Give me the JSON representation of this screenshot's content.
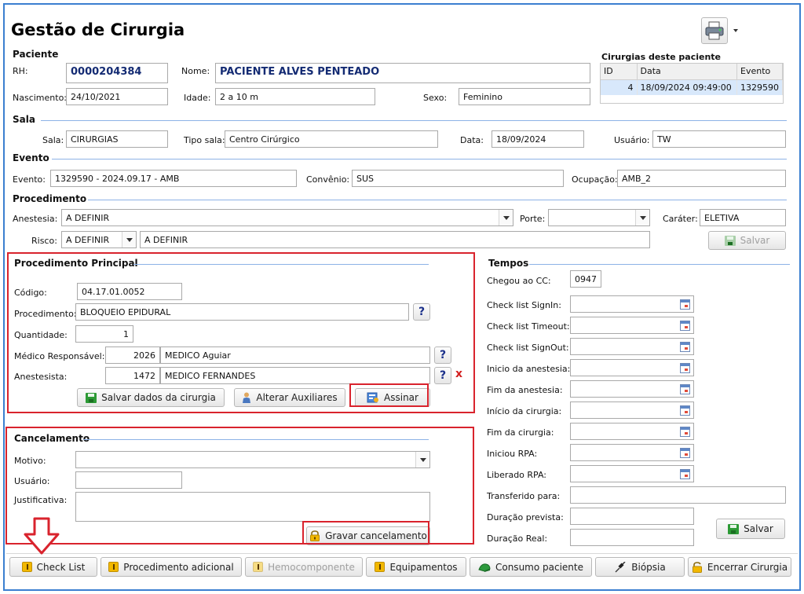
{
  "title": "Gestão de Cirurgia",
  "paciente": {
    "section": "Paciente",
    "rh_label": "RH:",
    "rh_value": "0000204384",
    "nome_label": "Nome:",
    "nome_value": "PACIENTE ALVES PENTEADO",
    "nascimento_label": "Nascimento:",
    "nascimento_value": "24/10/2021",
    "idade_label": "Idade:",
    "idade_value": "2 a 10 m",
    "sexo_label": "Sexo:",
    "sexo_value": "Feminino"
  },
  "cirurgias": {
    "title": "Cirurgias deste paciente",
    "headers": [
      "ID",
      "Data",
      "Evento"
    ],
    "rows": [
      {
        "id": "4",
        "data": "18/09/2024 09:49:00",
        "evento": "1329590"
      }
    ]
  },
  "sala": {
    "section": "Sala",
    "sala_label": "Sala:",
    "sala_value": "CIRURGIAS",
    "tipo_label": "Tipo sala:",
    "tipo_value": "Centro Cirúrgico",
    "data_label": "Data:",
    "data_value": "18/09/2024",
    "usuario_label": "Usuário:",
    "usuario_value": "TW"
  },
  "evento": {
    "section": "Evento",
    "evento_label": "Evento:",
    "evento_value": "1329590 - 2024.09.17 - AMB",
    "convenio_label": "Convênio:",
    "convenio_value": "SUS",
    "ocupacao_label": "Ocupação:",
    "ocupacao_value": "AMB_2"
  },
  "procedimento": {
    "section": "Procedimento",
    "anestesia_label": "Anestesia:",
    "anestesia_value": "A DEFINIR",
    "porte_label": "Porte:",
    "porte_value": "",
    "carater_label": "Caráter:",
    "carater_value": "ELETIVA",
    "risco_label": "Risco:",
    "risco_value": "A DEFINIR",
    "risco_desc": "A DEFINIR",
    "salvar_label": "Salvar"
  },
  "principal": {
    "section": "Procedimento Principal",
    "codigo_label": "Código:",
    "codigo_value": "04.17.01.0052",
    "procedimento_label": "Procedimento:",
    "procedimento_value": "BLOQUEIO EPIDURAL",
    "quantidade_label": "Quantidade:",
    "quantidade_value": "1",
    "medico_label": "Médico Responsável:",
    "medico_id": "2026",
    "medico_nome": "MEDICO Aguiar",
    "anestesista_label": "Anestesista:",
    "anestesista_id": "1472",
    "anestesista_nome": "MEDICO FERNANDES",
    "help": "?",
    "remove": "x",
    "btn_salvar": "Salvar dados da cirurgia",
    "btn_auxiliares": "Alterar Auxiliares",
    "btn_assinar": "Assinar"
  },
  "cancelamento": {
    "section": "Cancelamento",
    "motivo_label": "Motivo:",
    "motivo_value": "",
    "usuario_label": "Usuário:",
    "usuario_value": "",
    "justificativa_label": "Justificativa:",
    "justificativa_value": "",
    "btn_gravar": "Gravar cancelamento"
  },
  "tempos": {
    "section": "Tempos",
    "fields": [
      {
        "label": "Chegou ao CC:",
        "value": "0947"
      },
      {
        "label": "Check list SignIn:",
        "value": ""
      },
      {
        "label": "Check list Timeout:",
        "value": ""
      },
      {
        "label": "Check list SignOut:",
        "value": ""
      },
      {
        "label": "Inicio da anestesia:",
        "value": ""
      },
      {
        "label": "Fim da anestesia:",
        "value": ""
      },
      {
        "label": "Início da cirurgia:",
        "value": ""
      },
      {
        "label": "Fim da cirurgia:",
        "value": ""
      },
      {
        "label": "Iniciou RPA:",
        "value": ""
      },
      {
        "label": "Liberado RPA:",
        "value": ""
      },
      {
        "label": "Transferido para:",
        "value": ""
      },
      {
        "label": "Duração prevista:",
        "value": ""
      },
      {
        "label": "Duração Real:",
        "value": ""
      }
    ],
    "btn_salvar": "Salvar"
  },
  "bottom": {
    "check_list": "Check List",
    "procedimento_adicional": "Procedimento adicional",
    "hemocomponente": "Hemocomponente",
    "equipamentos": "Equipamentos",
    "consumo_paciente": "Consumo paciente",
    "biopsia": "Biópsia",
    "encerrar": "Encerrar Cirurgia"
  }
}
